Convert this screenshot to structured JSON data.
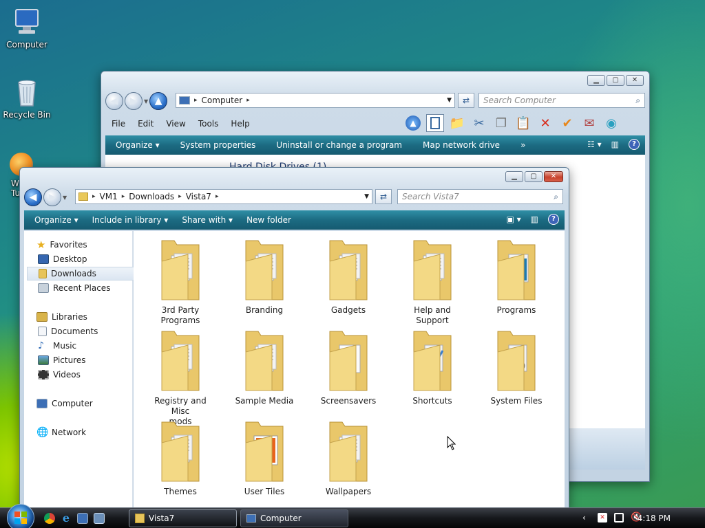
{
  "desktop": {
    "icons": [
      {
        "label": "Computer"
      },
      {
        "label": "Recycle Bin"
      },
      {
        "label": "W\nTu"
      }
    ]
  },
  "back_window": {
    "address": "Computer",
    "search_placeholder": "Search Computer",
    "menu": [
      "File",
      "Edit",
      "View",
      "Tools",
      "Help"
    ],
    "commands": [
      "Organize",
      "System properties",
      "Uninstall or change a program",
      "Map network drive",
      "»"
    ],
    "partial_text": "Hard Disk Drives (1)"
  },
  "front_window": {
    "breadcrumb": [
      "VM1",
      "Downloads",
      "Vista7"
    ],
    "search_placeholder": "Search Vista7",
    "commands": [
      "Organize",
      "Include in library",
      "Share with",
      "New folder"
    ],
    "nav": {
      "favorites": "Favorites",
      "desktop": "Desktop",
      "downloads": "Downloads",
      "recent": "Recent Places",
      "libraries": "Libraries",
      "documents": "Documents",
      "music": "Music",
      "pictures": "Pictures",
      "videos": "Videos",
      "computer": "Computer",
      "network": "Network"
    },
    "folders": [
      {
        "label": "3rd Party\nPrograms",
        "art": "papers"
      },
      {
        "label": "Branding",
        "art": "papers"
      },
      {
        "label": "Gadgets",
        "art": "papers"
      },
      {
        "label": "Help and Support",
        "art": "papers"
      },
      {
        "label": "Programs",
        "art": "blue"
      },
      {
        "label": "Registry and Misc\nmods",
        "art": "papers"
      },
      {
        "label": "Sample Media",
        "art": "papers"
      },
      {
        "label": "Screensavers",
        "art": "doc"
      },
      {
        "label": "Shortcuts",
        "art": "tools"
      },
      {
        "label": "System Files",
        "art": "gear"
      },
      {
        "label": "Themes",
        "art": "papers"
      },
      {
        "label": "User Tiles",
        "art": "orange"
      },
      {
        "label": "Wallpapers",
        "art": "papers"
      }
    ]
  },
  "taskbar": {
    "tasks": [
      "Vista7",
      "Computer"
    ],
    "clock": "4:18 PM"
  }
}
